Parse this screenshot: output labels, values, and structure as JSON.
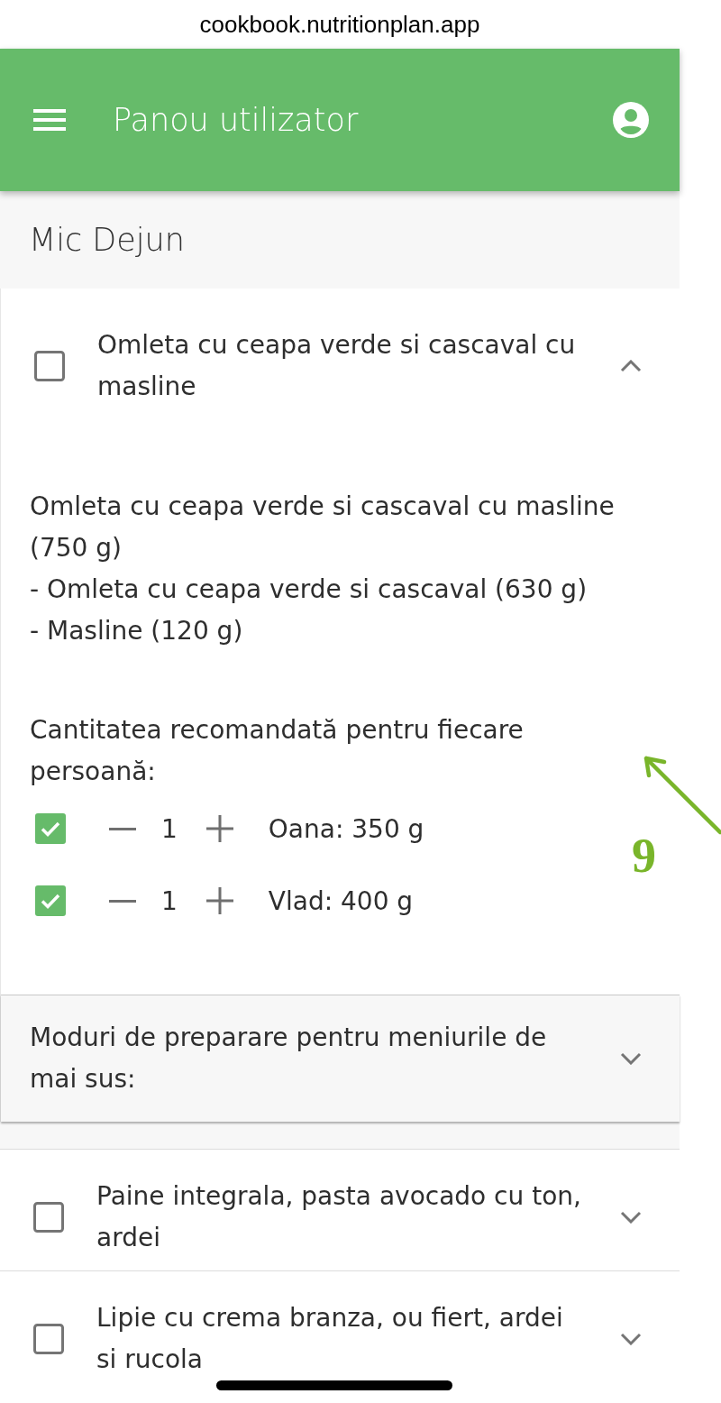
{
  "browser": {
    "url": "cookbook.nutritionplan.app"
  },
  "app_bar": {
    "title": "Panou utilizator"
  },
  "section": {
    "title": "Mic Dejun"
  },
  "meals": [
    {
      "title": "Omleta cu ceapa verde si cascaval cu masline",
      "checked": false,
      "expanded": true,
      "details": {
        "summary": "Omleta cu ceapa verde si cascaval cu masline (750 g)",
        "components": [
          "- Omleta cu ceapa verde si cascaval (630 g)",
          "- Masline (120 g)"
        ],
        "portions_label": "Cantitatea recomandată pentru fiecare persoană:",
        "portions": [
          {
            "checked": true,
            "quantity": "1",
            "label": "Oana: 350 g"
          },
          {
            "checked": true,
            "quantity": "1",
            "label": "Vlad: 400 g"
          }
        ],
        "preparation": {
          "title": "Moduri de preparare pentru meniurile de mai sus:",
          "expanded": false
        }
      }
    },
    {
      "title": "Paine integrala, pasta avocado cu ton, ardei",
      "checked": false,
      "expanded": false
    },
    {
      "title": "Lipie cu crema branza, ou fiert, ardei si rucola",
      "checked": false,
      "expanded": false
    }
  ],
  "annotation": {
    "label": "9"
  }
}
